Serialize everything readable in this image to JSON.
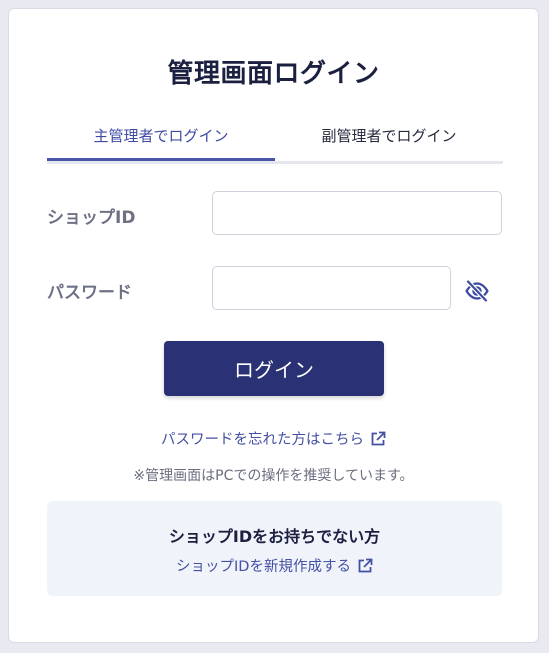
{
  "page": {
    "title": "管理画面ログイン"
  },
  "tabs": [
    {
      "label": "主管理者でログイン",
      "active": true
    },
    {
      "label": "副管理者でログイン",
      "active": false
    }
  ],
  "form": {
    "shop_id_label": "ショップID",
    "shop_id_value": "",
    "password_label": "パスワード",
    "password_value": "",
    "toggle_icon": "eye-off-icon",
    "submit_label": "ログイン"
  },
  "links": {
    "forgot_password": "パスワードを忘れた方はこちら",
    "external_icon": "external-link-icon"
  },
  "notice": "※管理画面はPCでの操作を推奨しています。",
  "no_id": {
    "title": "ショップIDをお持ちでない方",
    "link": "ショップIDを新規作成する"
  },
  "colors": {
    "primary": "#2a3175",
    "link": "#4450a4",
    "active_tab": "#3f4ba3",
    "info_box": "#f0f3fa"
  }
}
